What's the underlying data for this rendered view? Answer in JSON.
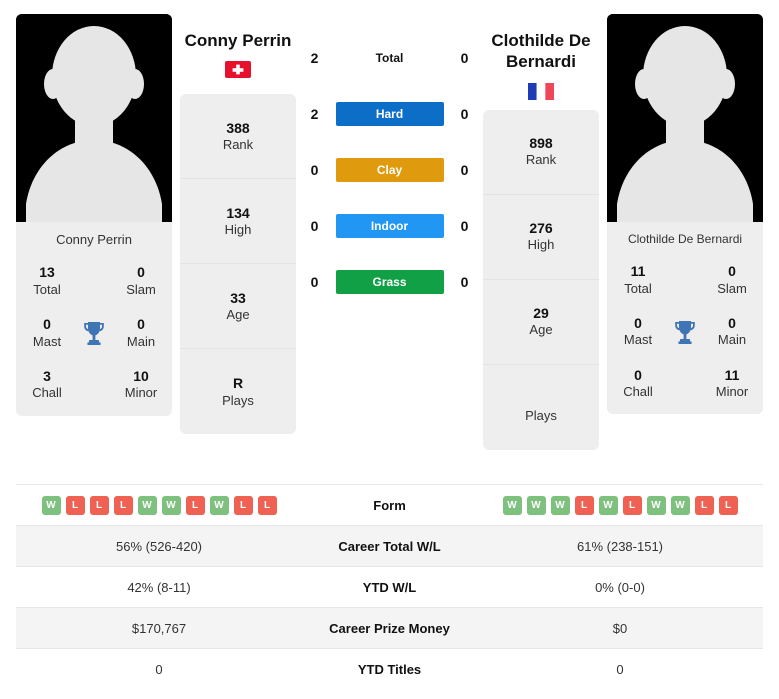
{
  "colors": {
    "hard": "#0d6ec8",
    "clay": "#e09a0d",
    "indoor": "#2196f3",
    "grass": "#12a047",
    "win_badge": "#7ec07e",
    "loss_badge": "#ef6153",
    "panel_bg": "#eeeeee",
    "swiss_red": "#e8112d",
    "france_blue": "#1e3cb4",
    "france_red": "#f0465a"
  },
  "left_player": {
    "name": "Conny Perrin",
    "caption": "Conny Perrin",
    "flag": "swiss-flag-icon",
    "flag_country": "Switzerland",
    "avatar": "player-avatar-silhouette",
    "rank_stats": [
      {
        "value": "388",
        "label": "Rank"
      },
      {
        "value": "134",
        "label": "High"
      },
      {
        "value": "33",
        "label": "Age"
      },
      {
        "value": "R",
        "label": "Plays"
      }
    ],
    "titles": [
      {
        "value": "13",
        "label": "Total"
      },
      {
        "value": "0",
        "label": "Slam"
      },
      {
        "value": "0",
        "label": "Mast"
      },
      {
        "value": "0",
        "label": "Main"
      },
      {
        "value": "3",
        "label": "Chall"
      },
      {
        "value": "10",
        "label": "Minor"
      }
    ],
    "trophy_icon": "trophy-icon",
    "form": [
      "W",
      "L",
      "L",
      "L",
      "W",
      "W",
      "L",
      "W",
      "L",
      "L"
    ],
    "career_total_wl": "56% (526-420)",
    "ytd_wl": "42% (8-11)",
    "career_prize_money": "$170,767",
    "ytd_titles": "0"
  },
  "right_player": {
    "name": "Clothilde De Bernardi",
    "caption": "Clothilde De Bernardi",
    "flag": "france-flag-icon",
    "flag_country": "France",
    "avatar": "player-avatar-silhouette",
    "rank_stats": [
      {
        "value": "898",
        "label": "Rank"
      },
      {
        "value": "276",
        "label": "High"
      },
      {
        "value": "29",
        "label": "Age"
      },
      {
        "value": "",
        "label": "Plays"
      }
    ],
    "titles": [
      {
        "value": "11",
        "label": "Total"
      },
      {
        "value": "0",
        "label": "Slam"
      },
      {
        "value": "0",
        "label": "Mast"
      },
      {
        "value": "0",
        "label": "Main"
      },
      {
        "value": "0",
        "label": "Chall"
      },
      {
        "value": "11",
        "label": "Minor"
      }
    ],
    "trophy_icon": "trophy-icon",
    "form": [
      "W",
      "W",
      "W",
      "L",
      "W",
      "L",
      "W",
      "W",
      "L",
      "L"
    ],
    "career_total_wl": "61% (238-151)",
    "ytd_wl": "0% (0-0)",
    "career_prize_money": "$0",
    "ytd_titles": "0"
  },
  "head_to_head": [
    {
      "label": "Total",
      "left": "2",
      "right": "0",
      "style": "plain"
    },
    {
      "label": "Hard",
      "left": "2",
      "right": "0",
      "style": "pill",
      "color": "#0d6ec8"
    },
    {
      "label": "Clay",
      "left": "0",
      "right": "0",
      "style": "pill",
      "color": "#e09a0d"
    },
    {
      "label": "Indoor",
      "left": "0",
      "right": "0",
      "style": "pill",
      "color": "#2196f3"
    },
    {
      "label": "Grass",
      "left": "0",
      "right": "0",
      "style": "pill",
      "color": "#12a047"
    }
  ],
  "table_rows": [
    {
      "label": "Form",
      "type": "form",
      "left": "",
      "right": ""
    },
    {
      "label": "Career Total W/L",
      "type": "text",
      "left": "56% (526-420)",
      "right": "61% (238-151)"
    },
    {
      "label": "YTD W/L",
      "type": "text",
      "left": "42% (8-11)",
      "right": "0% (0-0)"
    },
    {
      "label": "Career Prize Money",
      "type": "text",
      "left": "$170,767",
      "right": "$0"
    },
    {
      "label": "YTD Titles",
      "type": "text",
      "left": "0",
      "right": "0"
    }
  ]
}
